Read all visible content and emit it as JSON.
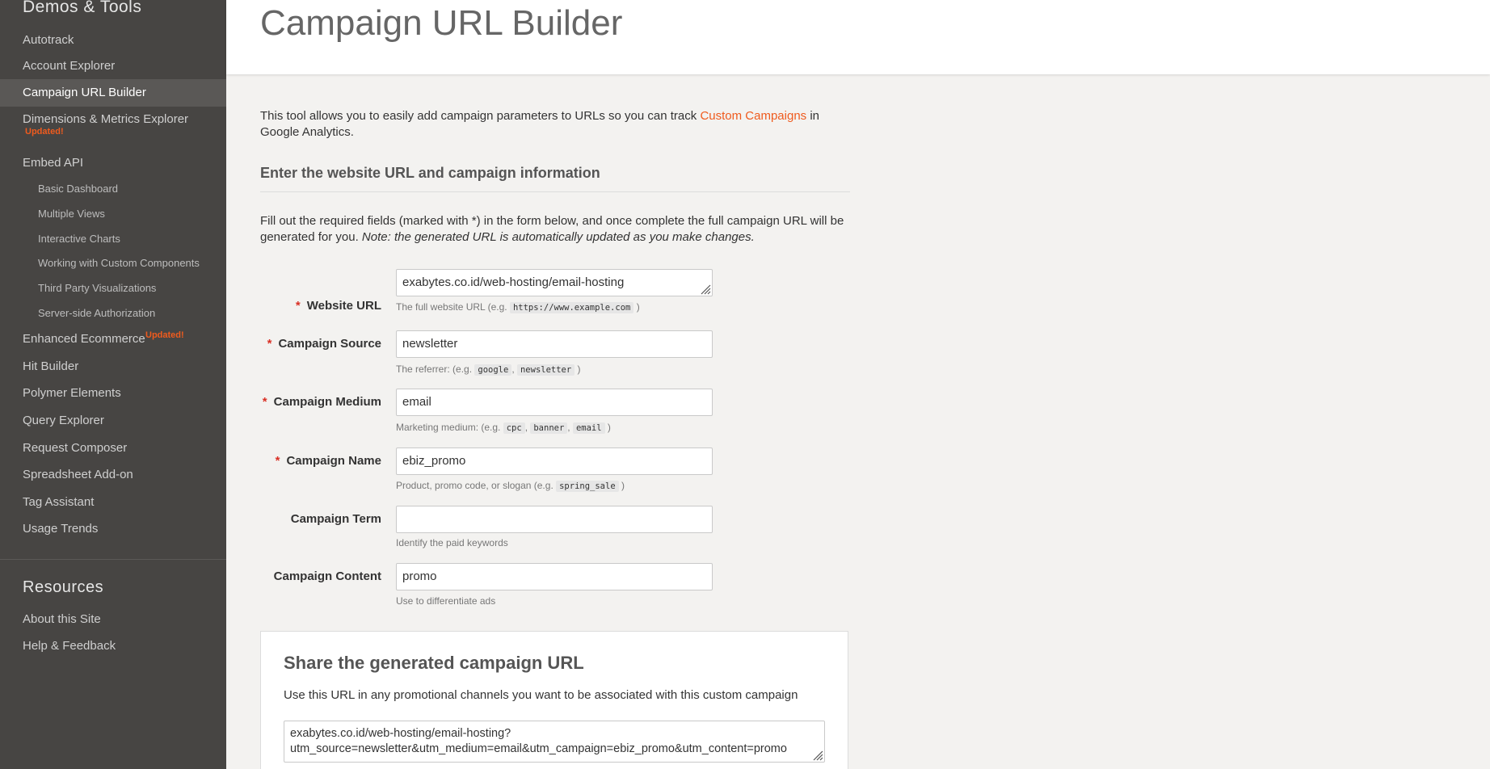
{
  "sidebar": {
    "section_demos": "Demos & Tools",
    "items": [
      "Autotrack",
      "Account Explorer",
      "Campaign URL Builder",
      "Dimensions & Metrics Explorer",
      "Embed API",
      "Enhanced Ecommerce",
      "Hit Builder",
      "Polymer Elements",
      "Query Explorer",
      "Request Composer",
      "Spreadsheet Add-on",
      "Tag Assistant",
      "Usage Trends"
    ],
    "embed_sub_items": [
      "Basic Dashboard",
      "Multiple Views",
      "Interactive Charts",
      "Working with Custom Components",
      "Third Party Visualizations",
      "Server-side Authorization"
    ],
    "updated_badge": "Updated!",
    "section_resources": "Resources",
    "resources_items": [
      "About this Site",
      "Help & Feedback"
    ]
  },
  "header": {
    "title": "Campaign URL Builder"
  },
  "intro": {
    "text_before": "This tool allows you to easily add campaign parameters to URLs so you can track ",
    "link": "Custom Campaigns",
    "text_after": " in Google Analytics."
  },
  "form_section": {
    "heading": "Enter the website URL and campaign information",
    "info_text": "Fill out the required fields (marked with *) in the form below, and once complete the full campaign URL will be generated for you. ",
    "info_note": "Note: the generated URL is automatically updated as you make changes."
  },
  "fields": {
    "required_mark": "*",
    "website_url": {
      "label": "Website URL",
      "value": "exabytes.co.id/web-hosting/email-hosting",
      "hint": "The full website URL (e.g. ",
      "codes": [
        "https://www.example.com"
      ],
      "hint_end": " )"
    },
    "campaign_source": {
      "label": "Campaign Source",
      "value": "newsletter",
      "hint": "The referrer: (e.g. ",
      "codes": [
        "google",
        "newsletter"
      ],
      "hint_end": " )"
    },
    "campaign_medium": {
      "label": "Campaign Medium",
      "value": "email",
      "hint": "Marketing medium: (e.g. ",
      "codes": [
        "cpc",
        "banner",
        "email"
      ],
      "hint_end": " )"
    },
    "campaign_name": {
      "label": "Campaign Name",
      "value": "ebiz_promo",
      "hint": "Product, promo code, or slogan (e.g. ",
      "codes": [
        "spring_sale"
      ],
      "hint_end": " )"
    },
    "campaign_term": {
      "label": "Campaign Term",
      "value": "",
      "hint": "Identify the paid keywords"
    },
    "campaign_content": {
      "label": "Campaign Content",
      "value": "promo",
      "hint": "Use to differentiate ads"
    }
  },
  "share": {
    "title": "Share the generated campaign URL",
    "description": "Use this URL in any promotional channels you want to be associated with this custom campaign",
    "url": "exabytes.co.id/web-hosting/email-hosting?utm_source=newsletter&utm_medium=email&utm_campaign=ebiz_promo&utm_content=promo"
  },
  "colors": {
    "sidebar_bg": "#474543",
    "sidebar_active": "#5a5856",
    "accent": "#ef5b1e",
    "required": "#d93025",
    "page_bg": "#f3f2f0"
  }
}
